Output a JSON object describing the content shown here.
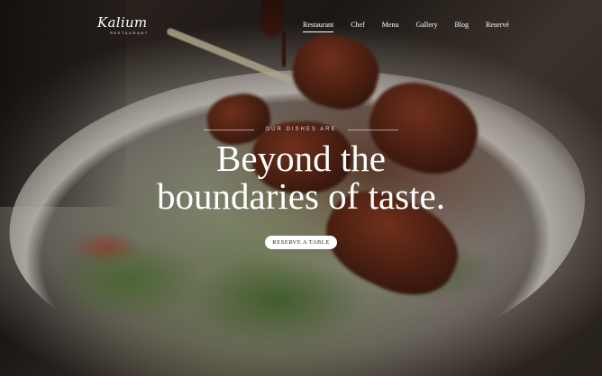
{
  "brand": {
    "name": "Kalium",
    "subtitle": "RESTAURANT"
  },
  "nav": {
    "items": [
      {
        "label": "Restaurant",
        "active": true
      },
      {
        "label": "Chef"
      },
      {
        "label": "Menu"
      },
      {
        "label": "Gallery"
      },
      {
        "label": "Blog"
      },
      {
        "label": "Reservé"
      }
    ]
  },
  "hero": {
    "eyebrow": "OUR DISHES ARE",
    "headline_line1": "Beyond the",
    "headline_line2": "boundaries of taste.",
    "cta_label": "RESERVE A TABLE"
  },
  "colors": {
    "text": "#ffffff",
    "cta_bg": "#ffffff",
    "cta_text": "#2a2220"
  }
}
